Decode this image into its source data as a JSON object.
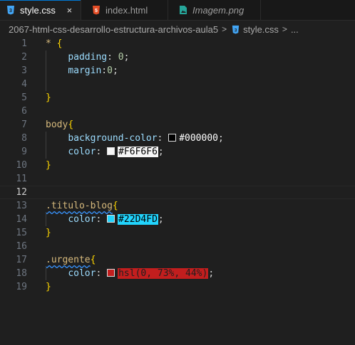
{
  "tabs": [
    {
      "label": "style.css",
      "icon": "css-icon",
      "active": true
    },
    {
      "label": "index.html",
      "icon": "html-icon",
      "active": false
    },
    {
      "label": "Imagem.png",
      "icon": "image-file-icon",
      "active": false
    }
  ],
  "tab_close_glyph": "×",
  "breadcrumb": {
    "folder": "2067-html-css-desarrollo-estructura-archivos-aula5",
    "file": "style.css",
    "more": "..."
  },
  "colors": {
    "black_value": "#000000",
    "light_value": "#F6F6F6",
    "blue_value": "#22D4FD",
    "red_value": "hsl(0, 73%, 44%)"
  },
  "code": {
    "l1_sel": "*",
    "l1_brace": "{",
    "l2_prop": "padding",
    "l2_val": "0",
    "l3_prop": "margin",
    "l3_val": "0",
    "l5_brace": "}",
    "l7_sel": "body",
    "l7_brace": "{",
    "l8_prop": "background-color",
    "l8_val": "#000000",
    "l9_prop": "color",
    "l9_val": "#F6F6F6",
    "l10_brace": "}",
    "l13_sel": ".titulo-blog",
    "l13_brace": "{",
    "l14_prop": "color",
    "l14_val": "#22D4FD",
    "l15_brace": "}",
    "l17_sel": ".urgente",
    "l17_brace": "{",
    "l18_prop": "color",
    "l18_val": "hsl(0, 73%, 44%)",
    "l19_brace": "}"
  },
  "line_numbers": [
    "1",
    "2",
    "3",
    "4",
    "5",
    "6",
    "7",
    "8",
    "9",
    "10",
    "11",
    "12",
    "13",
    "14",
    "15",
    "16",
    "17",
    "18",
    "19"
  ],
  "current_line": "12"
}
